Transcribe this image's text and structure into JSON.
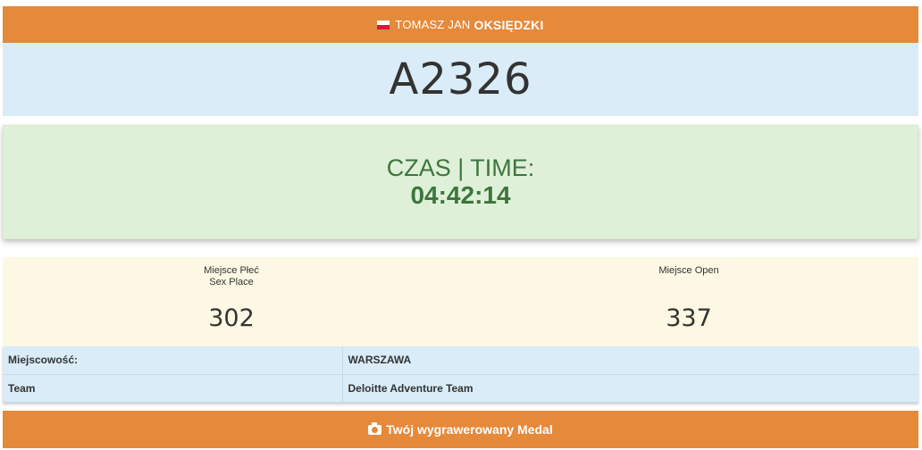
{
  "athlete": {
    "flag_icon": "flag-poland-icon",
    "first_name": "TOMASZ JAN",
    "last_name": "OKSIĘDZKI"
  },
  "bib": "A2326",
  "result": {
    "time_label": "CZAS | TIME:",
    "time_value": "04:42:14"
  },
  "places": {
    "sex_label_line1": "Miejsce Płeć",
    "sex_label_line2": "Sex Place",
    "sex_value": "302",
    "open_label": "Miejsce Open",
    "open_value": "337"
  },
  "info": {
    "city_label": "Miejscowość:",
    "city_value": "WARSZAWA",
    "team_label": "Team",
    "team_value": "Deloitte Adventure Team"
  },
  "medal": {
    "icon": "camera-icon",
    "label": "Twój wygrawerowany Medal"
  },
  "colors": {
    "accent_orange": "#e5893a",
    "info_blue": "#d9ecf7",
    "success_green_bg": "#dff0d8",
    "success_green_text": "#3c763d",
    "warning_yellow_bg": "#fcf8e3"
  }
}
